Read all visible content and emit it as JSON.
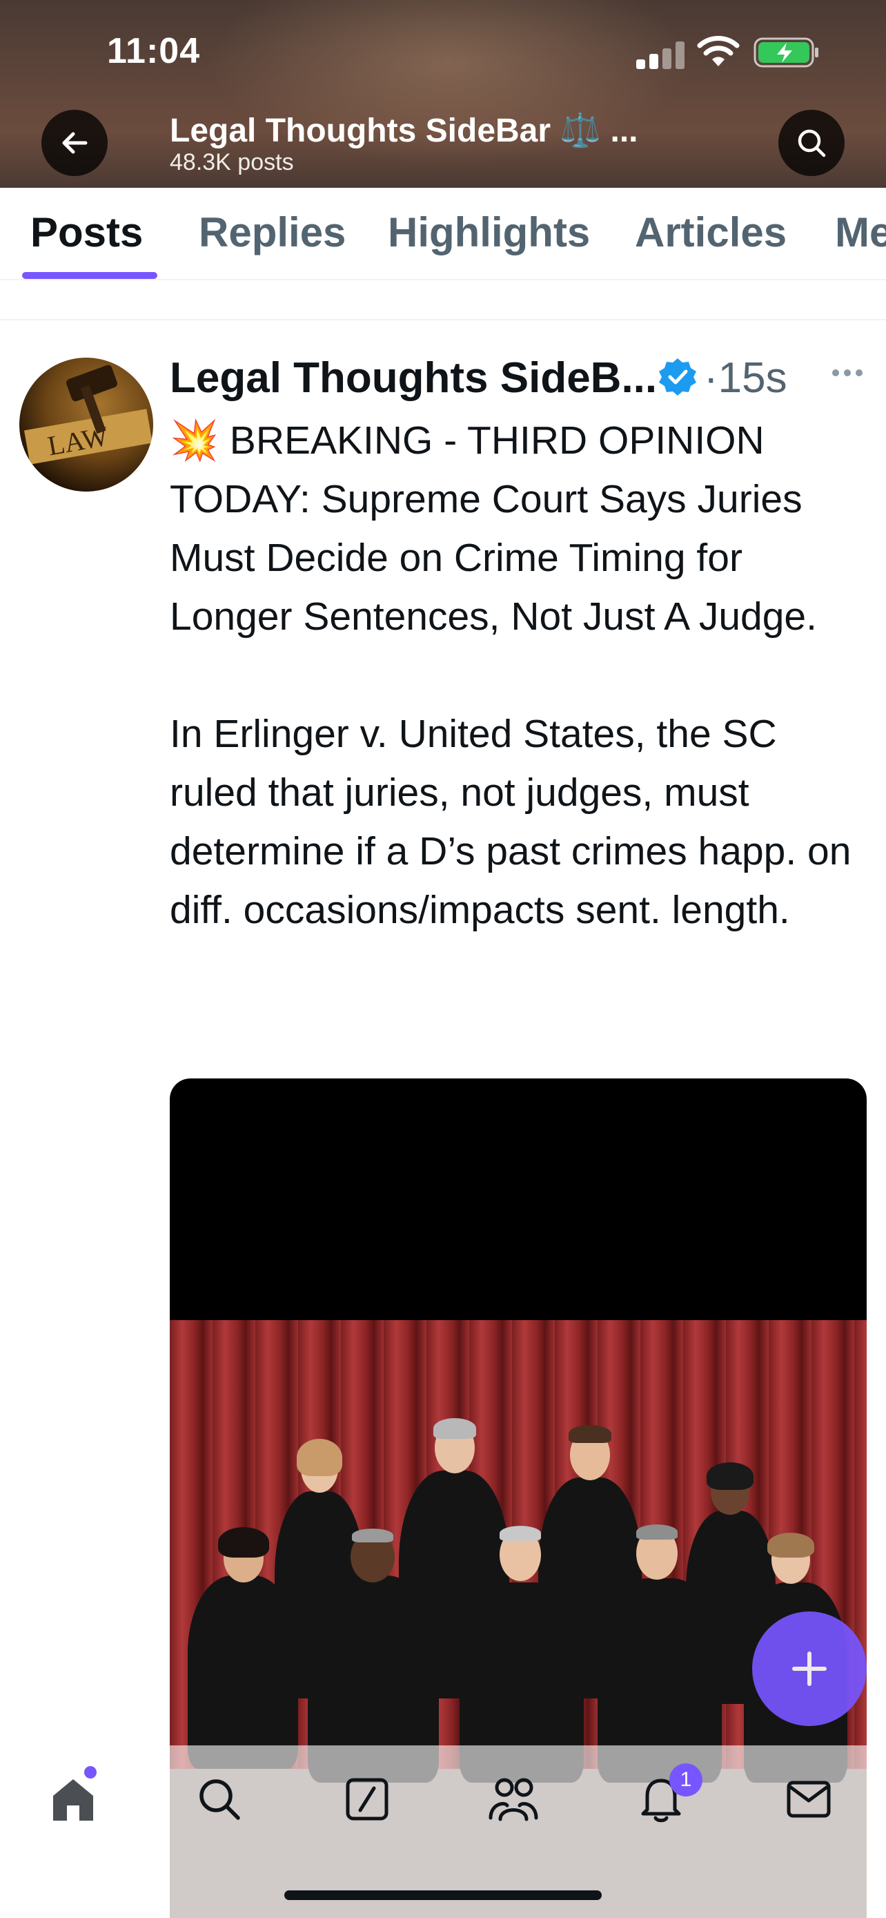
{
  "status_bar": {
    "time": "11:04"
  },
  "header": {
    "title": "Legal Thoughts SideBar ⚖️ ...",
    "post_count": "48.3K posts",
    "back_icon": "arrow-left-icon",
    "search_icon": "search-icon"
  },
  "tabs": [
    {
      "label": "Posts",
      "active": true
    },
    {
      "label": "Replies",
      "active": false
    },
    {
      "label": "Highlights",
      "active": false
    },
    {
      "label": "Articles",
      "active": false
    },
    {
      "label": "Me",
      "active": false
    }
  ],
  "post": {
    "avatar_text": "LAW",
    "author": "Legal Thoughts SideB...",
    "verified": true,
    "time": "·15s",
    "paragraphs": [
      "💥 BREAKING - THIRD OPINION TODAY: Supreme Court Says Juries Must Decide on Crime Timing for Longer Sentences, Not Just A Judge.",
      "In Erlinger v. United States, the SC ruled that juries, not judges, must determine if a D’s past crimes happ. on diff. occasions/impacts sent. length."
    ]
  },
  "bottom_nav": {
    "items": [
      "home-icon",
      "search-icon",
      "grok-icon",
      "communities-icon",
      "notifications-icon",
      "messages-icon"
    ],
    "notification_count": "1"
  },
  "colors": {
    "accent": "#7856ff",
    "verified": "#1d9bf0",
    "text_primary": "#0f1419",
    "text_secondary": "#536471"
  }
}
